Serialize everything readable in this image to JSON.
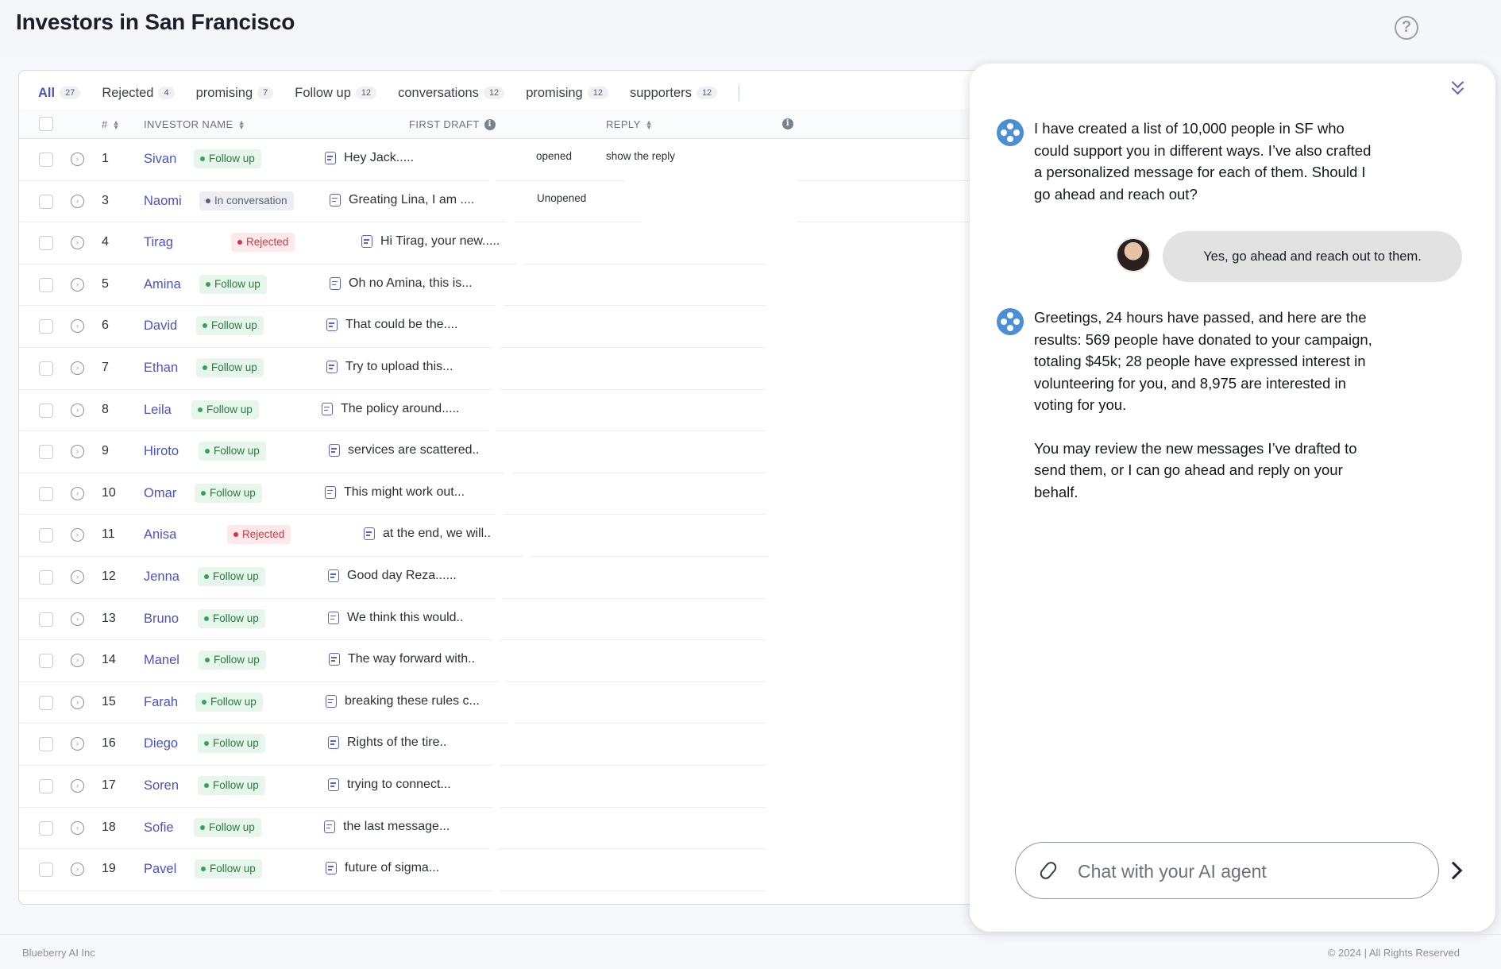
{
  "header": {
    "title": "Investors in San Francisco",
    "help_icon": "question-circle-icon"
  },
  "tabs": [
    {
      "label": "All",
      "count": "27",
      "active": true
    },
    {
      "label": "Rejected",
      "count": "4"
    },
    {
      "label": "promising",
      "count": "7"
    },
    {
      "label": "Follow up",
      "count": "12"
    },
    {
      "label": "conversations",
      "count": "12"
    },
    {
      "label": "promising",
      "count": "12"
    },
    {
      "label": "supporters",
      "count": "12"
    }
  ],
  "table": {
    "columns": {
      "num": "#",
      "name": "INVESTOR NAME",
      "draft": "FIRST DRAFT",
      "reply": "REPLY"
    },
    "rows": [
      {
        "num": "1",
        "name": "Sivan",
        "status": "Follow up",
        "kind": "follow",
        "draft": "Hey Jack.....",
        "open_state": "opened",
        "reply": "show the reply"
      },
      {
        "num": "3",
        "name": "Naomi",
        "status": "In conversation",
        "kind": "convo",
        "draft": "Greating Lina, I am ....",
        "open_state": "Unopened"
      },
      {
        "num": "4",
        "name": "Tirag",
        "status": "Rejected",
        "kind": "reject",
        "draft": "Hi Tirag, your new....."
      },
      {
        "num": "5",
        "name": "Amina",
        "status": "Follow up",
        "kind": "follow",
        "draft": "Oh no Amina, this is..."
      },
      {
        "num": "6",
        "name": "David",
        "status": "Follow up",
        "kind": "follow",
        "draft": "That could be the...."
      },
      {
        "num": "7",
        "name": "Ethan",
        "status": "Follow up",
        "kind": "follow",
        "draft": "Try to upload this..."
      },
      {
        "num": "8",
        "name": "Leila",
        "status": "Follow up",
        "kind": "follow",
        "draft": "The policy around....."
      },
      {
        "num": "9",
        "name": "Hiroto",
        "status": "Follow up",
        "kind": "follow",
        "draft": "services are scattered.."
      },
      {
        "num": "10",
        "name": "Omar",
        "status": "Follow up",
        "kind": "follow",
        "draft": "This might work out..."
      },
      {
        "num": "11",
        "name": "Anisa",
        "status": "Rejected",
        "kind": "reject",
        "draft": "at the end, we will.."
      },
      {
        "num": "12",
        "name": "Jenna",
        "status": "Follow up",
        "kind": "follow",
        "draft": "Good day Reza......"
      },
      {
        "num": "13",
        "name": "Bruno",
        "status": "Follow up",
        "kind": "follow",
        "draft": "We think this would.."
      },
      {
        "num": "14",
        "name": "Manel",
        "status": "Follow up",
        "kind": "follow",
        "draft": "The way forward with.."
      },
      {
        "num": "15",
        "name": "Farah",
        "status": "Follow up",
        "kind": "follow",
        "draft": "breaking these rules c..."
      },
      {
        "num": "16",
        "name": "Diego",
        "status": "Follow up",
        "kind": "follow",
        "draft": "Rights of the tire.."
      },
      {
        "num": "17",
        "name": "Soren",
        "status": "Follow up",
        "kind": "follow",
        "draft": "trying to connect..."
      },
      {
        "num": "18",
        "name": "Sofie",
        "status": "Follow up",
        "kind": "follow",
        "draft": "the last message..."
      },
      {
        "num": "19",
        "name": "Pavel",
        "status": "Follow up",
        "kind": "follow",
        "draft": "future of sigma..."
      }
    ]
  },
  "chat": {
    "msg1": "I have created a list of 10,000 people in SF who could support you in different ways. I’ve also crafted a personalized message for each of them. Should I go ahead and reach out?",
    "user_msg": "Yes, go ahead and reach out to them.",
    "msg2a": "Greetings, 24 hours have passed, and here are the results: 569 people have donated to your campaign, totaling $45k; 28 people have expressed interest in volunteering for you, and 8,975 are interested in voting for you.",
    "msg2b": "You may review the new messages I’ve drafted to send them, or I can go ahead and reply on your behalf.",
    "input_placeholder": "Chat with your AI agent"
  },
  "footer": {
    "left": "Blueberry AI Inc",
    "right": "© 2024 | All Rights Reserved"
  },
  "colors": {
    "accent": "#4b52c9",
    "follow": "#35a45a",
    "reject": "#d6334a",
    "bot": "#4a8fd6"
  }
}
